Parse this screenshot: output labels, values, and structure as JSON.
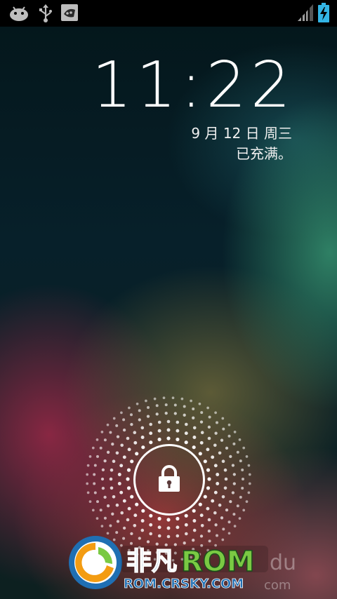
{
  "status_bar": {
    "icons": [
      "android-debug-icon",
      "usb-icon",
      "screenshot-icon",
      "signal-icon",
      "battery-charging-icon"
    ]
  },
  "lockscreen": {
    "time": "11:22",
    "date": "9 月 12 日 周三",
    "charge_status": "已充满。",
    "unlock_icon": "lock-icon"
  },
  "watermark": {
    "brand_cn": "非凡",
    "brand_rom": "ROM",
    "url": "ROM.CRSKY.COM",
    "partial_text": "du",
    "partial_sub": "com"
  },
  "colors": {
    "accent_green": "#7ac943",
    "battery_blue": "#33b5e5",
    "watermark_blue": "#1f6fb3"
  }
}
